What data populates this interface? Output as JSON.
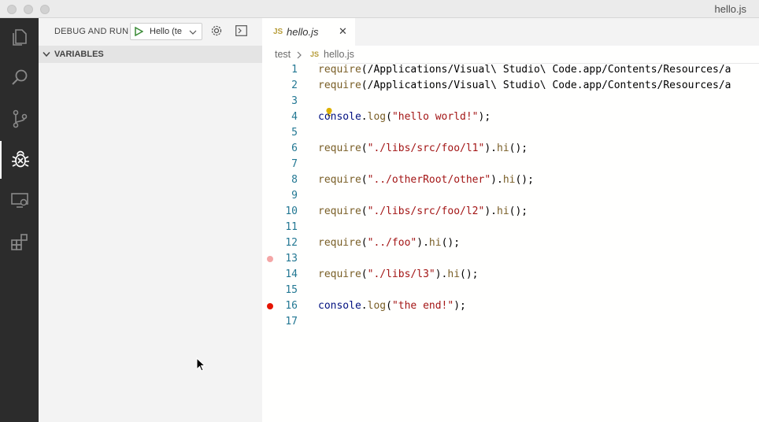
{
  "window": {
    "title": "hello.js"
  },
  "sidebar": {
    "title": "DEBUG AND RUN",
    "config_label": "Hello (te",
    "variables_label": "VARIABLES"
  },
  "editor": {
    "tab": {
      "icon_text": "JS",
      "name": "hello.js"
    },
    "breadcrumb": {
      "folder": "test",
      "file_icon": "JS",
      "file": "hello.js"
    },
    "lines": [
      {
        "n": "1",
        "text": "require(\"/Applications/Visual\\ Studio\\ Code.app/Contents/Resources/a"
      },
      {
        "n": "2",
        "text": "require(\"/Applications/Visual\\ Studio\\ Code.app/Contents/Resources/a"
      },
      {
        "n": "3",
        "text": ""
      },
      {
        "n": "4",
        "text": "console.log(\"hello world!\");"
      },
      {
        "n": "5",
        "text": ""
      },
      {
        "n": "6",
        "text": "require(\"./libs/src/foo/l1\").hi();"
      },
      {
        "n": "7",
        "text": ""
      },
      {
        "n": "8",
        "text": "require(\"../otherRoot/other\").hi();"
      },
      {
        "n": "9",
        "text": ""
      },
      {
        "n": "10",
        "text": "require(\"./libs/src/foo/l2\").hi();"
      },
      {
        "n": "11",
        "text": ""
      },
      {
        "n": "12",
        "text": "require(\"../foo\").hi();"
      },
      {
        "n": "13",
        "text": ""
      },
      {
        "n": "14",
        "text": "require(\"./libs/l3\").hi();"
      },
      {
        "n": "15",
        "text": ""
      },
      {
        "n": "16",
        "text": "console.log(\"the end!\");"
      },
      {
        "n": "17",
        "text": ""
      }
    ],
    "breakpoints": {
      "line13": "#f4a6a6",
      "line16": "#e51400"
    }
  },
  "colors": {
    "activity_bg": "#2c2c2c",
    "sidebar_bg": "#f3f3f3",
    "string": "#a31515",
    "function": "#795e26"
  }
}
